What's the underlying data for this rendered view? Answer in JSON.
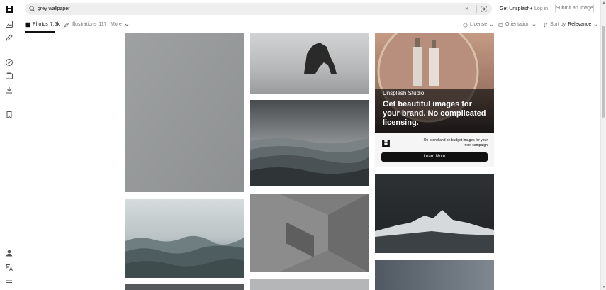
{
  "search": {
    "query": "grey wallpaper",
    "icons": [
      "search-icon",
      "clear-icon",
      "visual-search-icon"
    ]
  },
  "header": {
    "get_plus": "Get Unsplash+",
    "login": "Log in",
    "submit": "Submit an image"
  },
  "tabs": {
    "photos_label": "Photos",
    "photos_count": "7.5k",
    "illustrations_label": "Illustrations",
    "illustrations_count": "117",
    "more_label": "More"
  },
  "filters": {
    "license": "License",
    "orientation": "Orientation",
    "sort_prefix": "Sort by",
    "sort_value": "Relevance"
  },
  "sidebar": {
    "icons": [
      "unsplash-logo",
      "photos-icon",
      "illustrations-icon",
      "explore-icon",
      "collections-icon",
      "download-icon",
      "bookmark-icon",
      "profile-icon",
      "language-icon",
      "menu-icon"
    ]
  },
  "ad": {
    "brand": "Unsplash",
    "brand_suffix": "Studio",
    "headline": "Get beautiful images for your brand. No complicated licensing.",
    "tagline": "On-brand and on budget images for your next campaign",
    "cta": "Learn More"
  },
  "photos": [
    {
      "name": "grey-paper-texture"
    },
    {
      "name": "sea-stack-rock"
    },
    {
      "name": "misty-mountain-layers"
    },
    {
      "name": "stormy-sea"
    },
    {
      "name": "grey-textured-hexagon"
    },
    {
      "name": "snowy-mountain-night"
    }
  ],
  "colors": {
    "accent": "#111111",
    "muted": "#767676",
    "search_bg": "#eeeeee"
  }
}
